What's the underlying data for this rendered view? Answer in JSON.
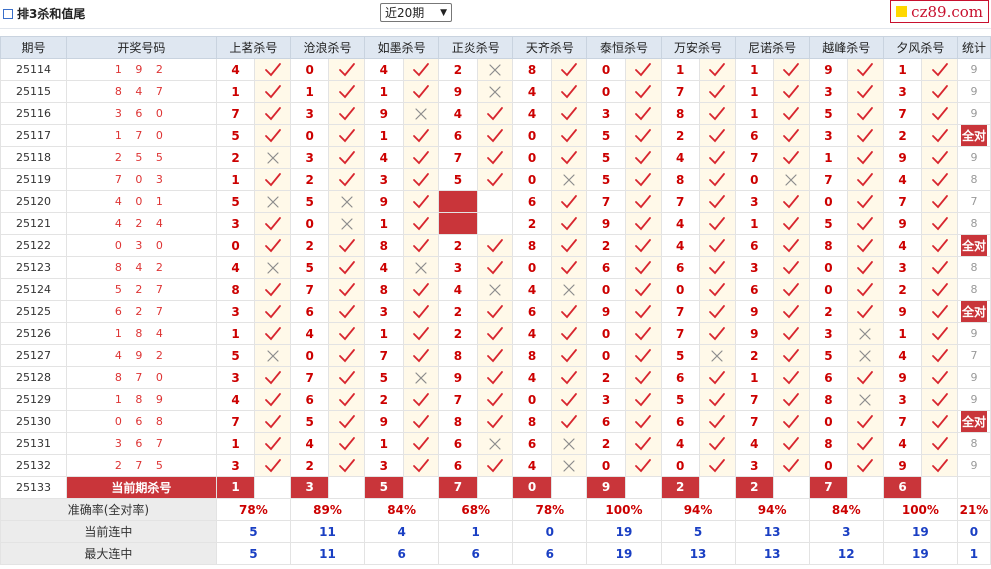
{
  "header": {
    "title": "排3杀和值尾",
    "period_select": "近20期",
    "logo": "cz89.com"
  },
  "table": {
    "columns": [
      "期号",
      "开奖号码",
      "上茗杀号",
      "沧浪杀号",
      "如墨杀号",
      "正炎杀号",
      "天齐杀号",
      "泰恒杀号",
      "万安杀号",
      "尼诺杀号",
      "越峰杀号",
      "夕风杀号",
      "统计"
    ],
    "rows": [
      {
        "issue": "25114",
        "draw": "1 9 2",
        "picks": [
          "4",
          "0",
          "4",
          "2",
          "8",
          "0",
          "1",
          "1",
          "9",
          "1"
        ],
        "marks": [
          "check",
          "check",
          "check",
          "cross",
          "check",
          "check",
          "check",
          "check",
          "check",
          "check"
        ],
        "stat": "9"
      },
      {
        "issue": "25115",
        "draw": "8 4 7",
        "picks": [
          "1",
          "1",
          "1",
          "9",
          "4",
          "0",
          "7",
          "1",
          "3",
          "3"
        ],
        "marks": [
          "check",
          "check",
          "check",
          "cross",
          "check",
          "check",
          "check",
          "check",
          "check",
          "check"
        ],
        "stat": "9"
      },
      {
        "issue": "25116",
        "draw": "3 6 0",
        "picks": [
          "7",
          "3",
          "9",
          "4",
          "4",
          "3",
          "8",
          "1",
          "5",
          "7"
        ],
        "marks": [
          "check",
          "check",
          "cross",
          "check",
          "check",
          "check",
          "check",
          "check",
          "check",
          "check"
        ],
        "stat": "9"
      },
      {
        "issue": "25117",
        "draw": "1 7 0",
        "picks": [
          "5",
          "0",
          "1",
          "6",
          "0",
          "5",
          "2",
          "6",
          "3",
          "2"
        ],
        "marks": [
          "check",
          "check",
          "check",
          "check",
          "check",
          "check",
          "check",
          "check",
          "check",
          "check"
        ],
        "stat": "全对"
      },
      {
        "issue": "25118",
        "draw": "2 5 5",
        "picks": [
          "2",
          "3",
          "4",
          "7",
          "0",
          "5",
          "4",
          "7",
          "1",
          "9"
        ],
        "marks": [
          "cross",
          "check",
          "check",
          "check",
          "check",
          "check",
          "check",
          "check",
          "check",
          "check"
        ],
        "stat": "9"
      },
      {
        "issue": "25119",
        "draw": "7 0 3",
        "picks": [
          "1",
          "2",
          "3",
          "5",
          "0",
          "5",
          "8",
          "0",
          "7",
          "4"
        ],
        "marks": [
          "check",
          "check",
          "check",
          "check",
          "cross",
          "check",
          "check",
          "cross",
          "check",
          "check"
        ],
        "stat": "8"
      },
      {
        "issue": "25120",
        "draw": "4 0 1",
        "picks": [
          "5",
          "5",
          "9",
          "",
          "6",
          "7",
          "7",
          "3",
          "0",
          "7"
        ],
        "marks": [
          "cross",
          "cross",
          "check",
          "",
          "check",
          "check",
          "check",
          "check",
          "check",
          "check"
        ],
        "stat": "7"
      },
      {
        "issue": "25121",
        "draw": "4 2 4",
        "picks": [
          "3",
          "0",
          "1",
          "",
          "2",
          "9",
          "4",
          "1",
          "5",
          "9"
        ],
        "marks": [
          "check",
          "cross",
          "check",
          "",
          "check",
          "check",
          "check",
          "check",
          "check",
          "check"
        ],
        "stat": "8"
      },
      {
        "issue": "25122",
        "draw": "0 3 0",
        "picks": [
          "0",
          "2",
          "8",
          "2",
          "8",
          "2",
          "4",
          "6",
          "8",
          "4"
        ],
        "marks": [
          "check",
          "check",
          "check",
          "check",
          "check",
          "check",
          "check",
          "check",
          "check",
          "check"
        ],
        "stat": "全对"
      },
      {
        "issue": "25123",
        "draw": "8 4 2",
        "picks": [
          "4",
          "5",
          "4",
          "3",
          "0",
          "6",
          "6",
          "3",
          "0",
          "3"
        ],
        "marks": [
          "cross",
          "check",
          "cross",
          "check",
          "check",
          "check",
          "check",
          "check",
          "check",
          "check"
        ],
        "stat": "8"
      },
      {
        "issue": "25124",
        "draw": "5 2 7",
        "picks": [
          "8",
          "7",
          "8",
          "4",
          "4",
          "0",
          "0",
          "6",
          "0",
          "2"
        ],
        "marks": [
          "check",
          "check",
          "check",
          "cross",
          "cross",
          "check",
          "check",
          "check",
          "check",
          "check"
        ],
        "stat": "8"
      },
      {
        "issue": "25125",
        "draw": "6 2 7",
        "picks": [
          "3",
          "6",
          "3",
          "2",
          "6",
          "9",
          "7",
          "9",
          "2",
          "9"
        ],
        "marks": [
          "check",
          "check",
          "check",
          "check",
          "check",
          "check",
          "check",
          "check",
          "check",
          "check"
        ],
        "stat": "全对"
      },
      {
        "issue": "25126",
        "draw": "1 8 4",
        "picks": [
          "1",
          "4",
          "1",
          "2",
          "4",
          "0",
          "7",
          "9",
          "3",
          "1"
        ],
        "marks": [
          "check",
          "check",
          "check",
          "check",
          "check",
          "check",
          "check",
          "check",
          "cross",
          "check"
        ],
        "stat": "9"
      },
      {
        "issue": "25127",
        "draw": "4 9 2",
        "picks": [
          "5",
          "0",
          "7",
          "8",
          "8",
          "0",
          "5",
          "2",
          "5",
          "4"
        ],
        "marks": [
          "cross",
          "check",
          "check",
          "check",
          "check",
          "check",
          "cross",
          "check",
          "cross",
          "check"
        ],
        "stat": "7"
      },
      {
        "issue": "25128",
        "draw": "8 7 0",
        "picks": [
          "3",
          "7",
          "5",
          "9",
          "4",
          "2",
          "6",
          "1",
          "6",
          "9"
        ],
        "marks": [
          "check",
          "check",
          "cross",
          "check",
          "check",
          "check",
          "check",
          "check",
          "check",
          "check"
        ],
        "stat": "9"
      },
      {
        "issue": "25129",
        "draw": "1 8 9",
        "picks": [
          "4",
          "6",
          "2",
          "7",
          "0",
          "3",
          "5",
          "7",
          "8",
          "3"
        ],
        "marks": [
          "check",
          "check",
          "check",
          "check",
          "check",
          "check",
          "check",
          "check",
          "cross",
          "check"
        ],
        "stat": "9"
      },
      {
        "issue": "25130",
        "draw": "0 6 8",
        "picks": [
          "7",
          "5",
          "9",
          "8",
          "8",
          "6",
          "6",
          "7",
          "0",
          "7"
        ],
        "marks": [
          "check",
          "check",
          "check",
          "check",
          "check",
          "check",
          "check",
          "check",
          "check",
          "check"
        ],
        "stat": "全对"
      },
      {
        "issue": "25131",
        "draw": "3 6 7",
        "picks": [
          "1",
          "4",
          "1",
          "6",
          "6",
          "2",
          "4",
          "4",
          "8",
          "4"
        ],
        "marks": [
          "check",
          "check",
          "check",
          "cross",
          "cross",
          "check",
          "check",
          "check",
          "check",
          "check"
        ],
        "stat": "8"
      },
      {
        "issue": "25132",
        "draw": "2 7 5",
        "picks": [
          "3",
          "2",
          "3",
          "6",
          "4",
          "0",
          "0",
          "3",
          "0",
          "9"
        ],
        "marks": [
          "check",
          "check",
          "check",
          "check",
          "cross",
          "check",
          "check",
          "check",
          "check",
          "check"
        ],
        "stat": "9"
      }
    ],
    "current": {
      "issue": "25133",
      "label": "当前期杀号",
      "picks": [
        "1",
        "3",
        "5",
        "7",
        "0",
        "9",
        "2",
        "2",
        "7",
        "6"
      ]
    },
    "accuracy": {
      "label": "准确率(全对率)",
      "values": [
        "78%",
        "89%",
        "84%",
        "68%",
        "78%",
        "100%",
        "94%",
        "94%",
        "84%",
        "100%"
      ],
      "stat": "21%"
    },
    "current_streak": {
      "label": "当前连中",
      "values": [
        "5",
        "11",
        "4",
        "1",
        "0",
        "19",
        "5",
        "13",
        "3",
        "19"
      ],
      "stat": "0"
    },
    "max_streak": {
      "label": "最大连中",
      "values": [
        "5",
        "11",
        "6",
        "6",
        "6",
        "19",
        "13",
        "13",
        "12",
        "19"
      ],
      "stat": "1"
    }
  },
  "icons": {
    "check": "check-icon",
    "cross": "cross-icon",
    "logo_square": "yellow-square"
  },
  "colors": {
    "accent": "#c9353a",
    "header_bg": "#dfe7f1",
    "mark_bg": "#fff9e9",
    "streak": "#1a3fc3"
  }
}
